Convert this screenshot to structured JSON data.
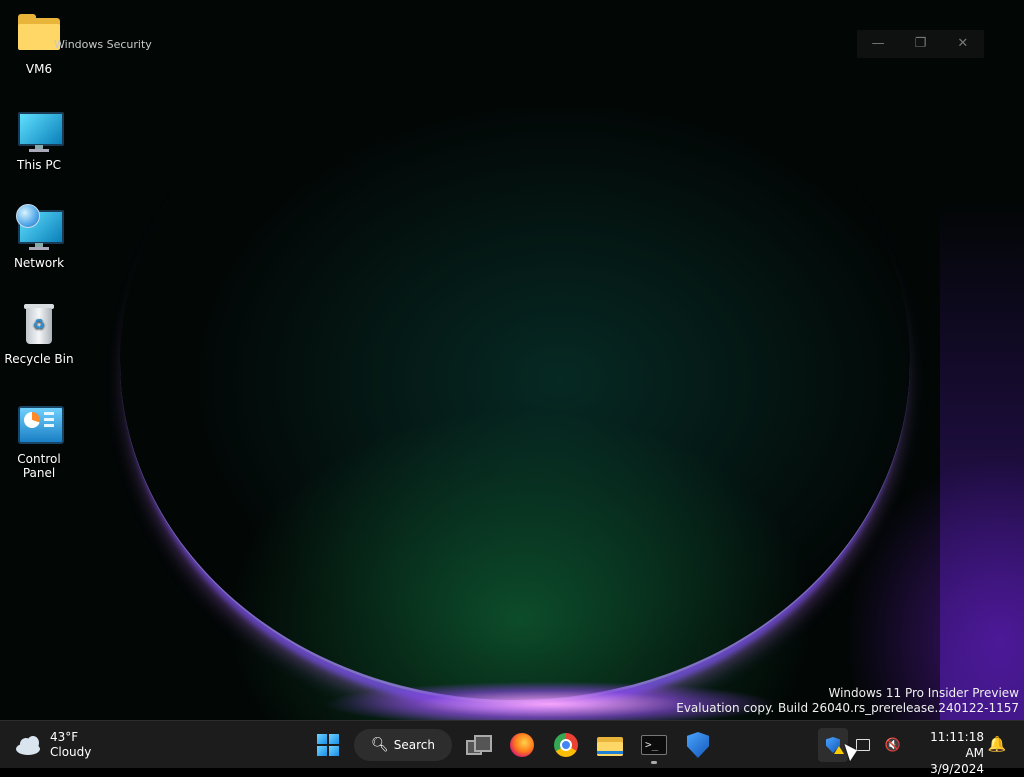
{
  "desktop": {
    "icons": [
      {
        "label": "VM6",
        "icon": "folder-icon"
      },
      {
        "label": "This PC",
        "icon": "monitor-icon"
      },
      {
        "label": "Network",
        "icon": "network-icon"
      },
      {
        "label": "Recycle Bin",
        "icon": "recycle-bin-icon"
      },
      {
        "label": "Control Panel",
        "icon": "control-panel-icon"
      }
    ]
  },
  "window": {
    "title": "Windows Security",
    "minimize_glyph": "—",
    "maximize_glyph": "❐",
    "close_glyph": "✕"
  },
  "watermark": {
    "line1": "Windows 11 Pro Insider Preview",
    "line2": "Evaluation copy. Build 26040.rs_prerelease.240122-1157"
  },
  "taskbar": {
    "weather": {
      "temp": "43°F",
      "condition": "Cloudy",
      "icon": "cloud-icon"
    },
    "search_label": "Search",
    "apps": [
      {
        "name": "start",
        "icon": "windows-logo-icon"
      },
      {
        "name": "task-view",
        "icon": "task-view-icon"
      },
      {
        "name": "firefox",
        "icon": "firefox-icon"
      },
      {
        "name": "chrome",
        "icon": "chrome-icon"
      },
      {
        "name": "file-explorer",
        "icon": "folder-icon"
      },
      {
        "name": "terminal",
        "icon": "terminal-icon"
      },
      {
        "name": "windows-security",
        "icon": "shield-icon"
      }
    ],
    "terminal_glyph": ">_",
    "tray": {
      "volume_glyph": "🔇",
      "bell_glyph": "🔔"
    },
    "clock": {
      "time": "11:11:18 AM",
      "date": "3/9/2024"
    }
  },
  "colors": {
    "taskbar": "#1c1c1c",
    "accent": "#1a8ee6",
    "warning": "#ffcc00"
  }
}
